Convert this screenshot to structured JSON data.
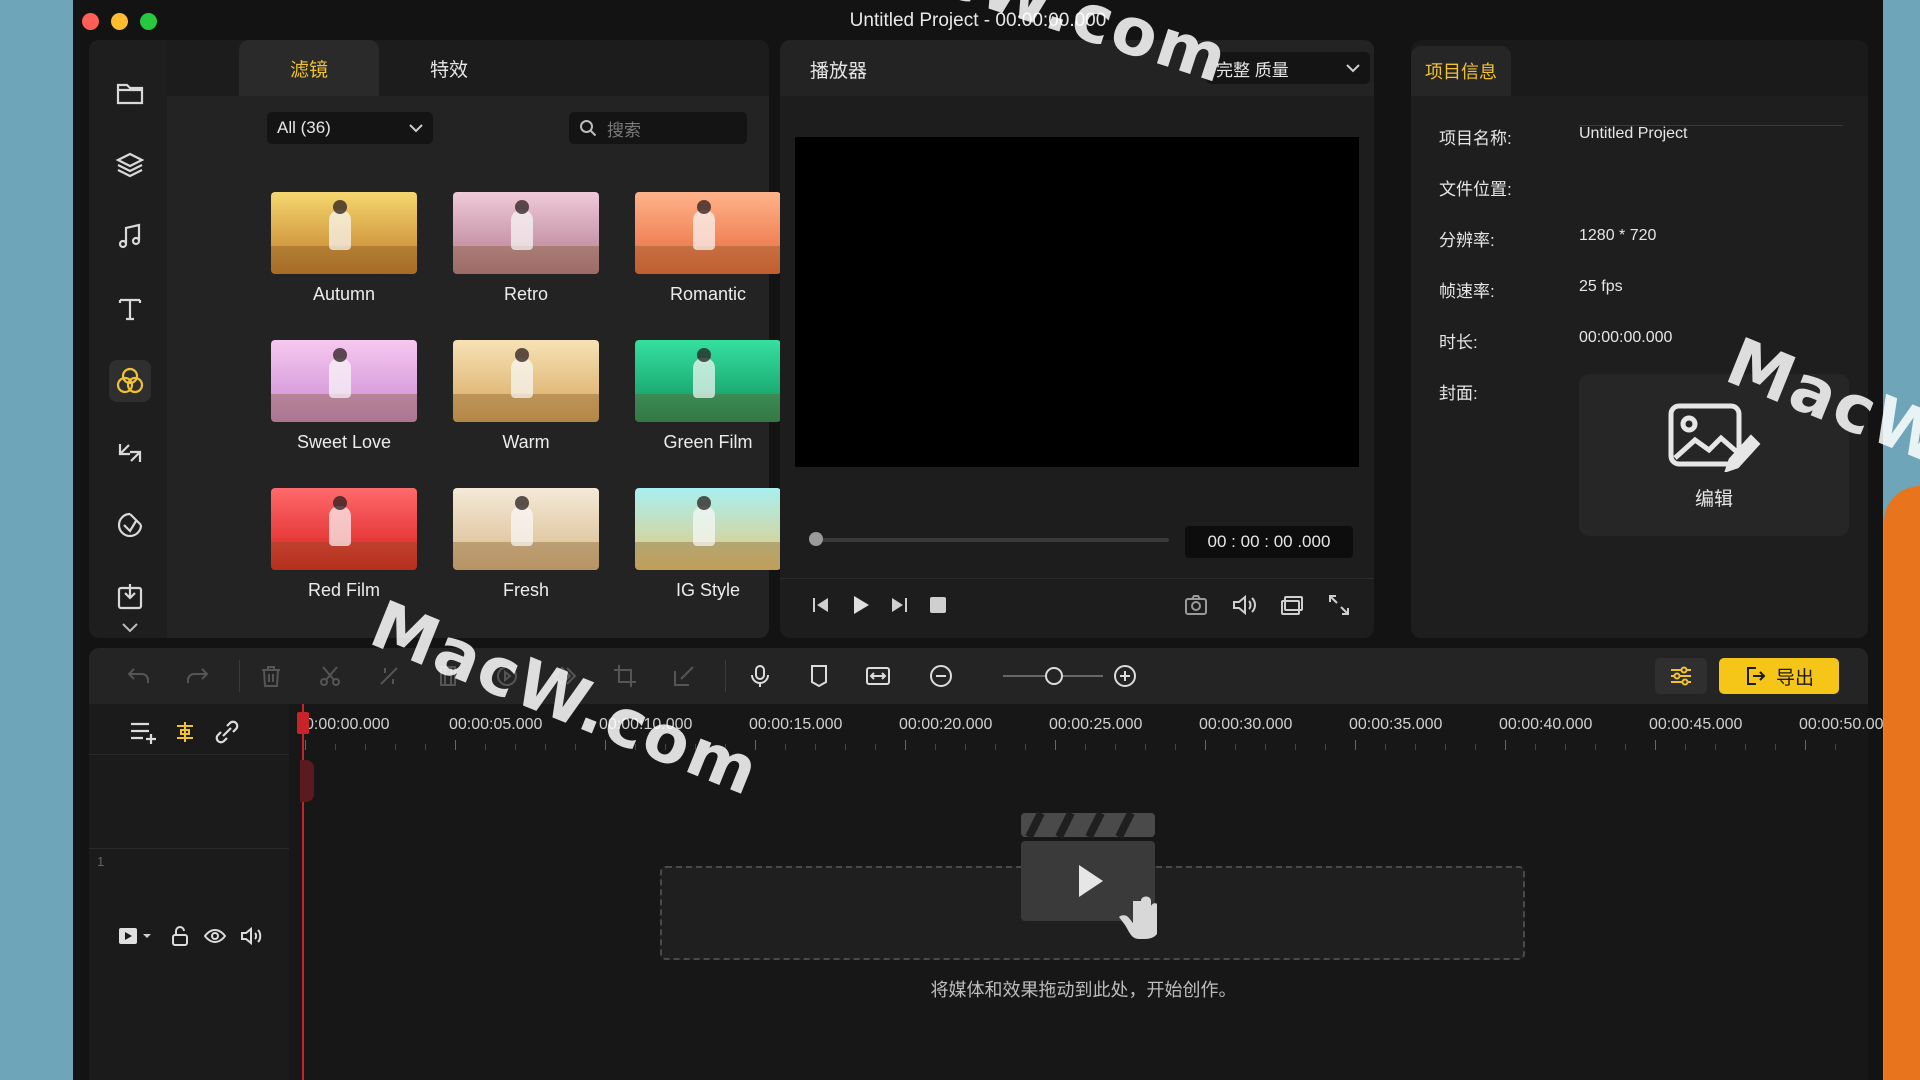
{
  "window": {
    "title": "Untitled Project - 00:00:00.000"
  },
  "library": {
    "tabs": [
      {
        "label": "滤镜"
      },
      {
        "label": "特效"
      }
    ],
    "category_select": "All (36)",
    "search_placeholder": "搜索",
    "filters": [
      {
        "name": "Autumn",
        "c1": "#f5d76e",
        "c2": "#c07a2a"
      },
      {
        "name": "Retro",
        "c1": "#f0c9d8",
        "c2": "#b07a8e"
      },
      {
        "name": "Romantic",
        "c1": "#ffb38a",
        "c2": "#e8663a"
      },
      {
        "name": "Sweet Love",
        "c1": "#f7c8f0",
        "c2": "#c78ad2"
      },
      {
        "name": "Warm",
        "c1": "#f7e2b5",
        "c2": "#d6a55c"
      },
      {
        "name": "Green Film",
        "c1": "#35e0a0",
        "c2": "#0f8f5a"
      },
      {
        "name": "Red Film",
        "c1": "#ff6a6a",
        "c2": "#d81e1e"
      },
      {
        "name": "Fresh",
        "c1": "#f4e9d8",
        "c2": "#d8b98a"
      },
      {
        "name": "IG Style",
        "c1": "#a8f0f0",
        "c2": "#e8c77a"
      }
    ]
  },
  "player": {
    "title": "播放器",
    "quality": "完整 质量",
    "timecode": "00 : 00 : 00 .000"
  },
  "info": {
    "tab": "项目信息",
    "rows": [
      {
        "label": "项目名称:",
        "value": "Untitled Project"
      },
      {
        "label": "文件位置:",
        "value": ""
      },
      {
        "label": "分辨率:",
        "value": "1280 * 720"
      },
      {
        "label": "帧速率:",
        "value": "25 fps"
      },
      {
        "label": "时长:",
        "value": "00:00:00.000"
      },
      {
        "label": "封面:",
        "value": ""
      }
    ],
    "cover_edit_label": "编辑"
  },
  "toolbar": {
    "export_label": "导出",
    "zoom_level": 0.5
  },
  "timeline": {
    "ticks": [
      "0:00:00.000",
      "00:00:05.000",
      "00:00:10.000",
      "00:00:15.000",
      "00:00:20.000",
      "00:00:25.000",
      "00:00:30.000",
      "00:00:35.000",
      "00:00:40.000",
      "00:00:45.000",
      "00:00:50.00"
    ],
    "track_number": "1",
    "drop_hint": "将媒体和效果拖动到此处，开始创作。"
  },
  "watermark": {
    "text": "MacW.com",
    "partial": "MacW.c"
  },
  "colors": {
    "accent": "#f1c232",
    "export_bg": "#f5c518",
    "playhead": "#c8232b"
  }
}
